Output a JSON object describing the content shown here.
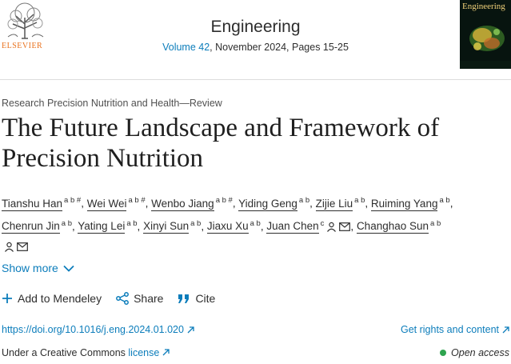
{
  "header": {
    "publisher_logo_text": "ELSEVIER",
    "journal": "Engineering",
    "volume": "Volume 42",
    "issue_info": ", November 2024, Pages 15-25",
    "cover_title": "Engineering"
  },
  "article": {
    "subject": "Research Precision Nutrition and Health—Review",
    "title": "The Future Landscape and Framework of Precision Nutrition",
    "authors": [
      {
        "name": "Tianshu Han",
        "aff": "a b #"
      },
      {
        "name": "Wei Wei",
        "aff": "a b #"
      },
      {
        "name": "Wenbo Jiang",
        "aff": "a b #"
      },
      {
        "name": "Yiding Geng",
        "aff": "a b"
      },
      {
        "name": "Zijie Liu",
        "aff": "a b"
      },
      {
        "name": "Ruiming Yang",
        "aff": "a b"
      },
      {
        "name": "Chenrun Jin",
        "aff": "a b"
      },
      {
        "name": "Yating Lei",
        "aff": "a b"
      },
      {
        "name": "Xinyi Sun",
        "aff": "a b"
      },
      {
        "name": "Jiaxu Xu",
        "aff": "a b"
      },
      {
        "name": "Juan Chen",
        "aff": "c"
      },
      {
        "name": "Changhao Sun",
        "aff": "a b"
      }
    ],
    "show_more": "Show more"
  },
  "actions": {
    "mendeley": "Add to Mendeley",
    "share": "Share",
    "cite": "Cite"
  },
  "links": {
    "doi": "https://doi.org/10.1016/j.eng.2024.01.020",
    "rights": "Get rights and content",
    "license_prefix": "Under a Creative Commons ",
    "license_link": "license",
    "open_access": "Open access"
  },
  "colors": {
    "link": "#0c7dbb",
    "elsevier_orange": "#e9711c",
    "open_access_dot": "#2ea44f"
  }
}
